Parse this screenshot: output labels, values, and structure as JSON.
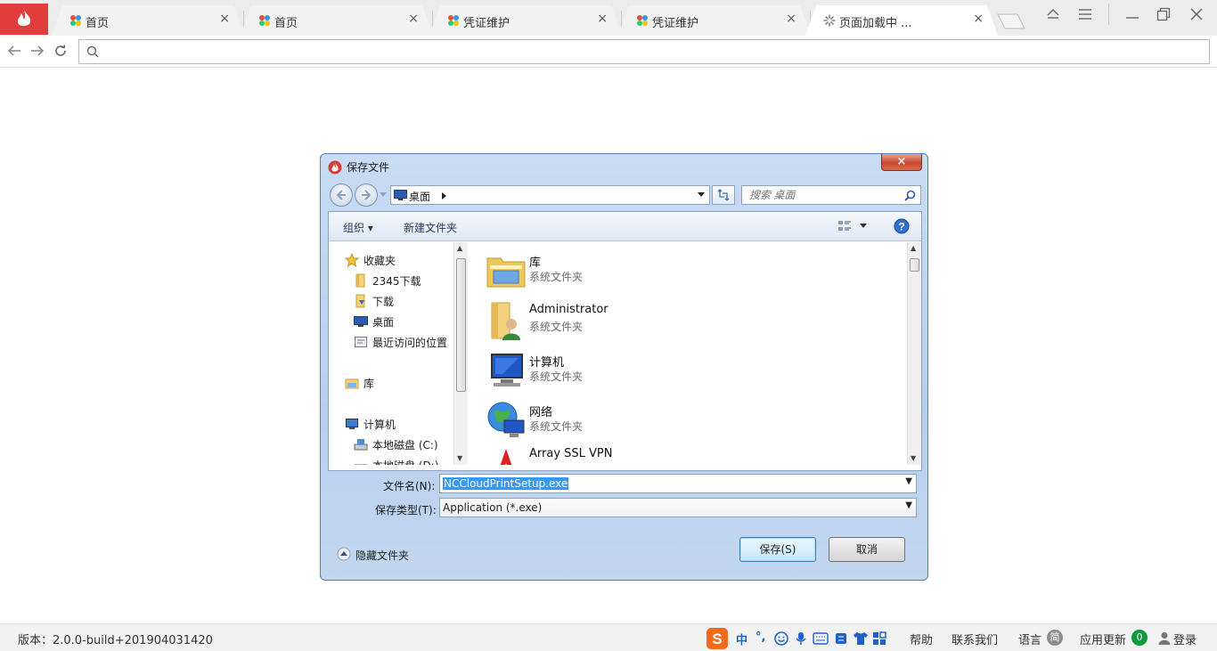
{
  "browser": {
    "tabs": [
      {
        "title": "首页",
        "icon": "app-grid-icon",
        "active": false
      },
      {
        "title": "首页",
        "icon": "app-grid-icon",
        "active": false
      },
      {
        "title": "凭证维护",
        "icon": "app-grid-icon",
        "active": false
      },
      {
        "title": "凭证维护",
        "icon": "app-grid-icon",
        "active": false
      },
      {
        "title": "页面加载中 ...",
        "icon": "loading-icon",
        "active": true
      }
    ],
    "close_glyph": "×",
    "address_value": "",
    "accent_color": "#e23c3c"
  },
  "dialog": {
    "title": "保存文件",
    "close_glyph": "×",
    "path": "桌面",
    "search_placeholder": "搜索 桌面",
    "toolbar": {
      "organize": "组织 ▾",
      "new_folder": "新建文件夹"
    },
    "nav": {
      "favorites": "收藏夹",
      "items_fav": [
        "2345下载",
        "下载",
        "桌面",
        "最近访问的位置"
      ],
      "library": "库",
      "computer": "计算机",
      "drives": [
        "本地磁盘 (C:)",
        "本地磁盘 (D:)"
      ]
    },
    "files": [
      {
        "name": "库",
        "type": "系统文件夹",
        "icon": "library-folder-icon"
      },
      {
        "name": "Administrator",
        "type": "系统文件夹",
        "icon": "user-folder-icon"
      },
      {
        "name": "计算机",
        "type": "系统文件夹",
        "icon": "computer-icon"
      },
      {
        "name": "网络",
        "type": "系统文件夹",
        "icon": "network-icon"
      },
      {
        "name": "Array SSL VPN",
        "type": "",
        "icon": "array-vpn-icon"
      }
    ],
    "filename_label": "文件名(N):",
    "filename_value": "NCCloudPrintSetup.exe",
    "filetype_label": "保存类型(T):",
    "filetype_value": "Application (*.exe)",
    "hide_folders": "隐藏文件夹",
    "save_button": "保存(S)",
    "cancel_button": "取消"
  },
  "statusbar": {
    "version": "版本：2.0.0-build+201904031420",
    "ime": [
      "中",
      "°,"
    ],
    "help": "帮助",
    "contact": "联系我们",
    "language": "语言",
    "language_badge": "简",
    "update": "应用更新",
    "update_count": "0",
    "login": "登录"
  }
}
